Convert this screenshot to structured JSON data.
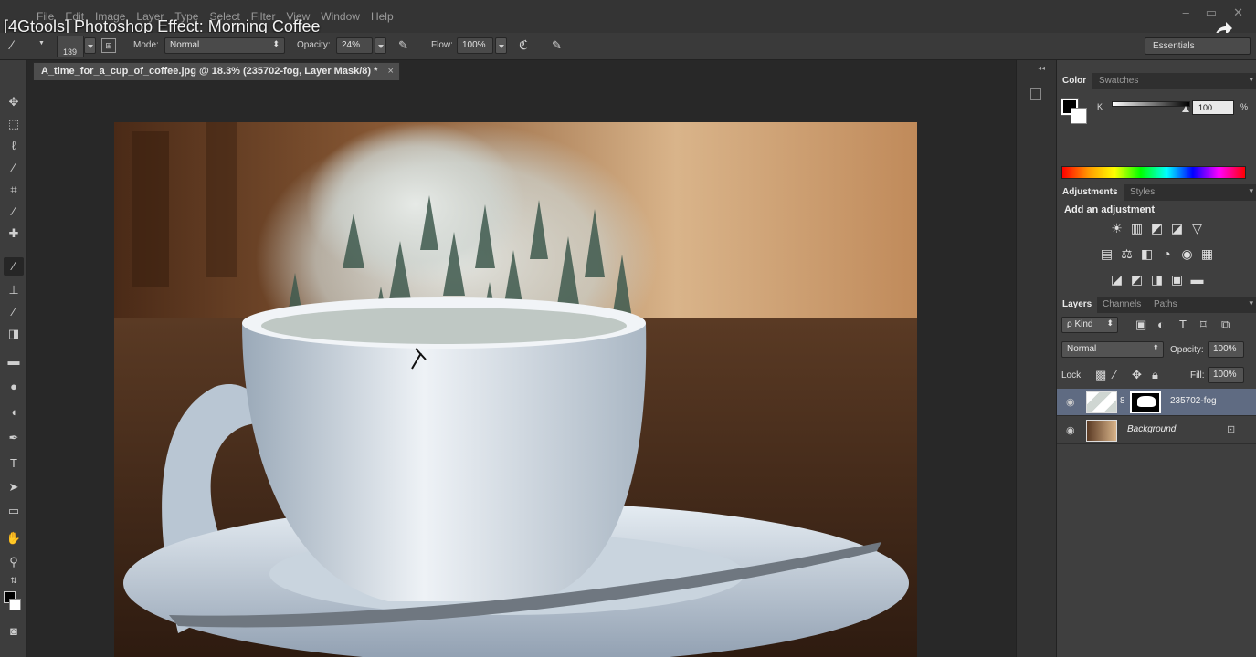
{
  "app": {
    "video_title": "[4Gtools] Photoshop Effect: Morning Coffee",
    "menus": [
      "File",
      "Edit",
      "Image",
      "Layer",
      "Type",
      "Select",
      "Filter",
      "View",
      "Window",
      "Help"
    ],
    "window_controls": [
      "–",
      "▭",
      "✕"
    ]
  },
  "options": {
    "brush_size": "139",
    "mode_label": "Mode:",
    "mode_value": "Normal",
    "opacity_label": "Opacity:",
    "opacity_value": "24%",
    "flow_label": "Flow:",
    "flow_value": "100%",
    "workspace": "Essentials"
  },
  "document": {
    "tab_title": "A_time_for_a_cup_of_coffee.jpg @ 18.3% (235702-fog, Layer Mask/8) *",
    "close": "×"
  },
  "color_panel": {
    "tabs": [
      "Color",
      "Swatches"
    ],
    "channel_label": "K",
    "value": "100",
    "unit": "%",
    "k_level": 1.0
  },
  "adjustments_panel": {
    "tabs": [
      "Adjustments",
      "Styles"
    ],
    "heading": "Add an adjustment",
    "row1": [
      "☀",
      "▥",
      "◩",
      "◪",
      "▽"
    ],
    "row2": [
      "▤",
      "⚖",
      "◧",
      "◔",
      "◉",
      "▦"
    ],
    "row3": [
      "◪",
      "◩",
      "◨",
      "▣",
      "▬"
    ]
  },
  "layers_panel": {
    "tabs": [
      "Layers",
      "Channels",
      "Paths"
    ],
    "filter_label": "ρ Kind",
    "blend_mode": "Normal",
    "opacity_label": "Opacity:",
    "opacity_value": "100%",
    "lock_label": "Lock:",
    "fill_label": "Fill:",
    "fill_value": "100%",
    "layers": [
      {
        "name": "235702-fog",
        "selected": true
      },
      {
        "name": "Background",
        "selected": false
      }
    ]
  },
  "colors": {
    "accent_selected_layer": "#5f6b82",
    "panel_bg": "#3f3f3f",
    "canvas_bg": "#282828"
  }
}
